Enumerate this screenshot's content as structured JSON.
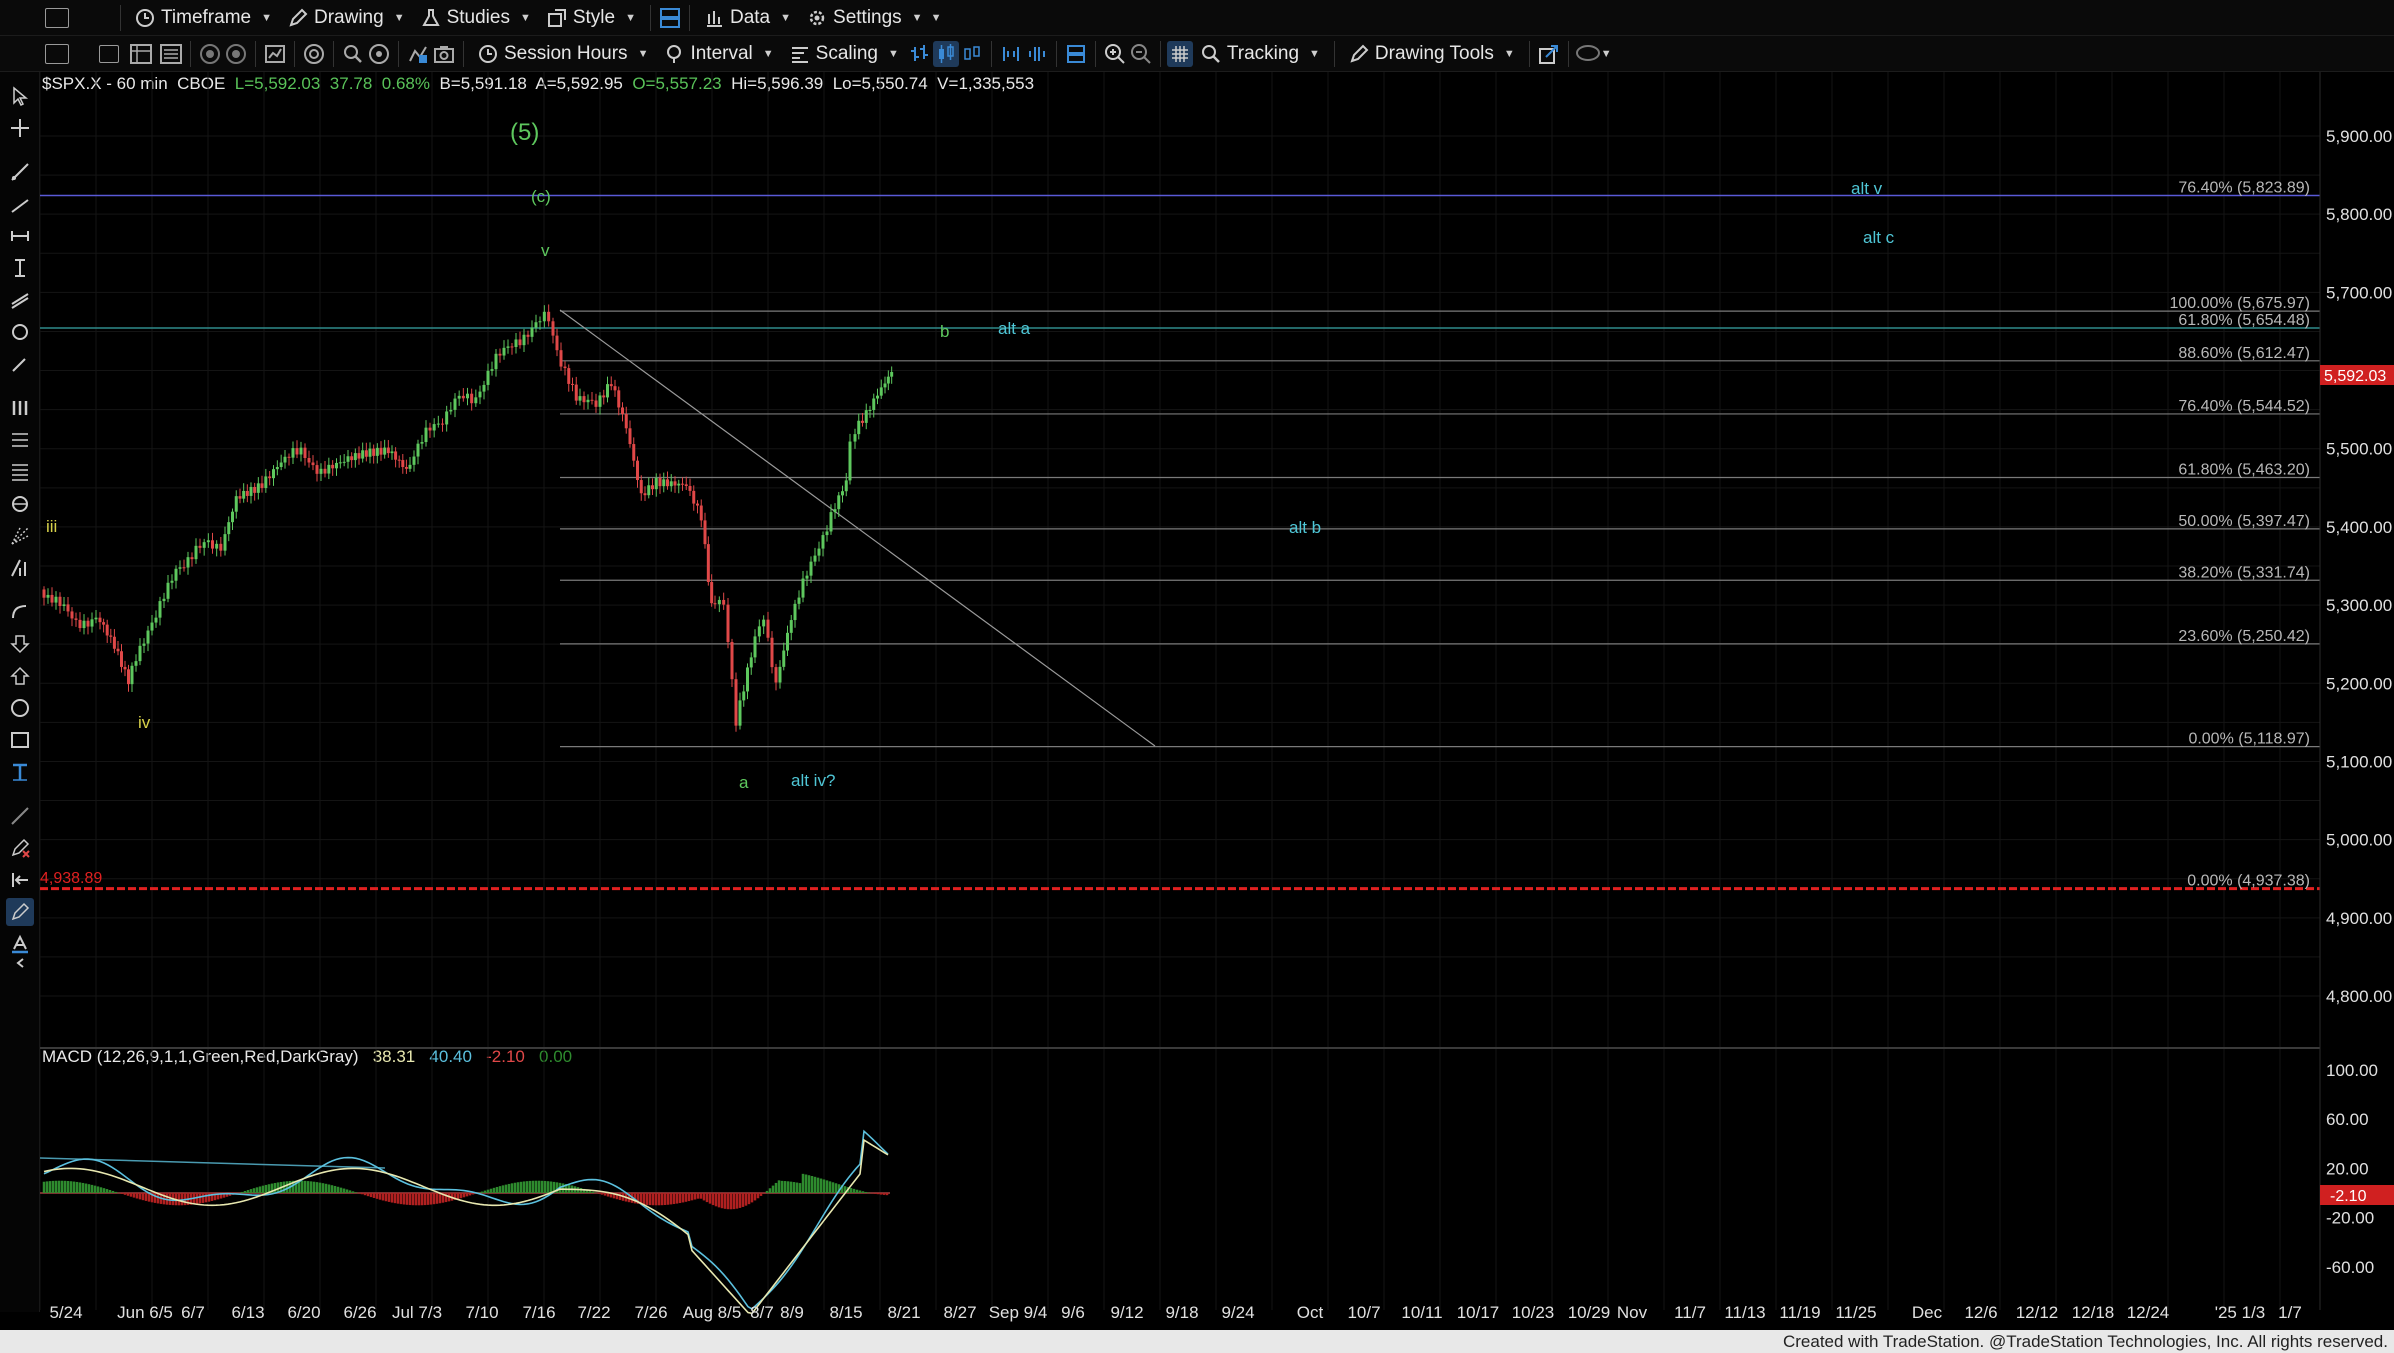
{
  "toolbar1": {
    "timeframe": "Timeframe",
    "drawing": "Drawing",
    "studies": "Studies",
    "style": "Style",
    "data": "Data",
    "settings": "Settings"
  },
  "toolbar2": {
    "session_hours": "Session Hours",
    "interval": "Interval",
    "scaling": "Scaling",
    "tracking": "Tracking",
    "drawing_tools": "Drawing Tools"
  },
  "symbol": {
    "name": "$SPX.X - 60 min",
    "exchange": "CBOE",
    "last": "L=5,592.03",
    "change": "37.78",
    "pct": "0.68%",
    "bid": "B=5,591.18",
    "ask": "A=5,592.95",
    "open": "O=5,557.23",
    "high": "Hi=5,596.39",
    "low": "Lo=5,550.74",
    "volume": "V=1,335,553"
  },
  "macd": {
    "label": "MACD (12,26,9,1,1,Green,Red,DarkGray)",
    "v1": "38.31",
    "v2": "40.40",
    "v3": "-2.10",
    "v4": "0.00"
  },
  "price_axis": [
    "5,900.00",
    "5,800.00",
    "5,700.00",
    "5,500.00",
    "5,400.00",
    "5,300.00",
    "5,200.00",
    "5,100.00",
    "5,000.00",
    "4,900.00",
    "4,800.00"
  ],
  "price_axis_values": [
    5900,
    5800,
    5700,
    5500,
    5400,
    5300,
    5200,
    5100,
    5000,
    4900,
    4800
  ],
  "last_price_tag": "5,592.03",
  "macd_axis": [
    "100.00",
    "60.00",
    "20.00",
    "-20.00",
    "-60.00"
  ],
  "macd_axis_values": [
    100,
    60,
    20,
    -20,
    -60
  ],
  "macd_tag": "-2.10",
  "date_axis": [
    "5/24",
    "Jun 6/5",
    "6/7",
    "6/13",
    "6/20",
    "6/26",
    "Jul 7/3",
    "7/10",
    "7/16",
    "7/22",
    "7/26",
    "Aug 8/5",
    "8/7",
    "8/9",
    "8/15",
    "8/21",
    "8/27",
    "Sep 9/4",
    "9/6",
    "9/12",
    "9/18",
    "9/24",
    "Oct",
    "10/7",
    "10/11",
    "10/17",
    "10/23",
    "10/29",
    "Nov",
    "11/7",
    "11/13",
    "11/19",
    "11/25",
    "Dec",
    "12/6",
    "12/12",
    "12/18",
    "12/24",
    "'25 1/3",
    "1/7"
  ],
  "fib_levels": [
    {
      "label": "100.00% (5,675.97)",
      "price": 5675.97
    },
    {
      "label": "88.60% (5,612.47)",
      "price": 5612.47
    },
    {
      "label": "76.40% (5,544.52)",
      "price": 5544.52
    },
    {
      "label": "61.80% (5,463.20)",
      "price": 5463.2
    },
    {
      "label": "50.00% (5,397.47)",
      "price": 5397.47
    },
    {
      "label": "38.20% (5,331.74)",
      "price": 5331.74
    },
    {
      "label": "23.60% (5,250.42)",
      "price": 5250.42
    },
    {
      "label": "0.00% (5,118.97)",
      "price": 5118.97
    }
  ],
  "other_levels": [
    {
      "label": "76.40% (5,823.89)",
      "price": 5823.89,
      "color": "#5a5ad6"
    },
    {
      "label": "61.80% (5,654.48)",
      "price": 5654.48,
      "color": "#2f8a8a"
    },
    {
      "label": "0.00% (4,937.38)",
      "price": 4937.38,
      "color": "#e02020"
    }
  ],
  "red_level_label": "4,938.89",
  "wave_labels": {
    "five": "(5)",
    "c_paren": "(c)",
    "v": "v",
    "b": "b",
    "alt_a": "alt a",
    "alt_v": "alt v",
    "alt_c": "alt c",
    "alt_b": "alt b",
    "iii": "iii",
    "iv": "iv",
    "a": "a",
    "alt_iv": "alt iv?"
  },
  "footer": "Created with TradeStation. @TradeStation Technologies, Inc. All rights reserved.",
  "colors": {
    "up_candle": "#5ec85e",
    "down_candle": "#e04848",
    "macd_line": "#e8e8b0",
    "signal_line": "#5bc0de",
    "hist_pos": "#2e8b2e",
    "hist_neg": "#b02020"
  }
}
